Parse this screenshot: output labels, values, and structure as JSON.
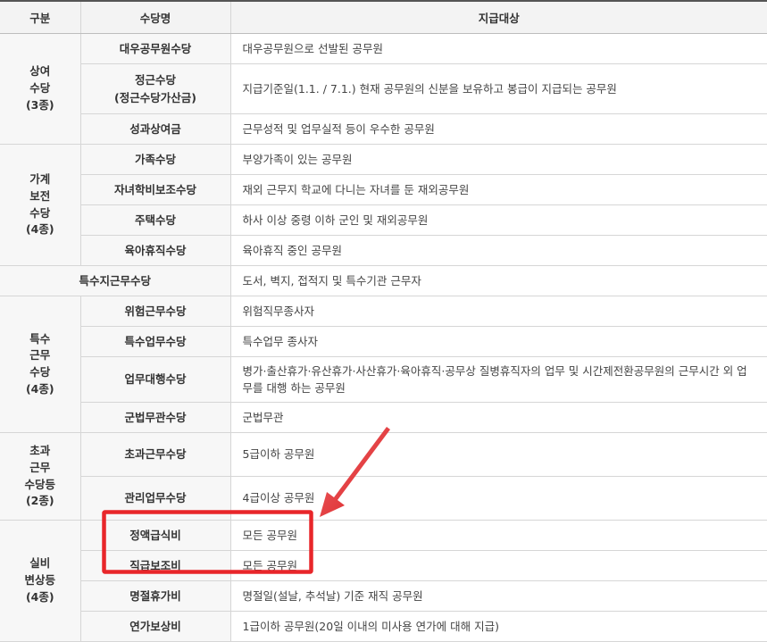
{
  "header": {
    "col1": "구분",
    "col2": "수당명",
    "col3": "지급대상"
  },
  "groups": {
    "g1": {
      "lines": [
        "상여",
        "수당",
        "(3종)"
      ]
    },
    "g2": {
      "lines": [
        "가계",
        "보전",
        "수당",
        "(4종)"
      ]
    },
    "g3": {
      "lines": [
        "특수",
        "근무",
        "수당",
        "(4종)"
      ]
    },
    "g4": {
      "lines": [
        "초과",
        "근무",
        "수당등",
        "(2종)"
      ]
    },
    "g5": {
      "lines": [
        "실비",
        "변상등",
        "(4종)"
      ]
    }
  },
  "rows": [
    {
      "name": "대우공무원수당",
      "target": "대우공무원으로 선발된 공무원"
    },
    {
      "name": "정근수당",
      "name_sub": "(정근수당가산금)",
      "target": "지급기준일(1.1. / 7.1.) 현재 공무원의 신분을 보유하고 봉급이 지급되는 공무원"
    },
    {
      "name": "성과상여금",
      "target": "근무성적 및 업무실적 등이 우수한 공무원"
    },
    {
      "name": "가족수당",
      "target": "부양가족이 있는 공무원"
    },
    {
      "name": "자녀학비보조수당",
      "target": "재외 근무지 학교에 다니는 자녀를 둔 재외공무원"
    },
    {
      "name": "주택수당",
      "target": "하사 이상 중령 이하 군인 및 재외공무원"
    },
    {
      "name": "육아휴직수당",
      "target": "육아휴직 중인 공무원"
    },
    {
      "name": "특수지근무수당",
      "target": "도서, 벽지, 접적지 및 특수기관 근무자"
    },
    {
      "name": "위험근무수당",
      "target": "위험직무종사자"
    },
    {
      "name": "특수업무수당",
      "target": "특수업무 종사자"
    },
    {
      "name": "업무대행수당",
      "target": "병가·출산휴가·유산휴가·사산휴가·육아휴직·공무상 질병휴직자의 업무 및 시간제전환공무원의 근무시간 외 업무를 대행 하는 공무원"
    },
    {
      "name": "군법무관수당",
      "target": "군법무관"
    },
    {
      "name": "초과근무수당",
      "target": "5급이하 공무원"
    },
    {
      "name": "관리업무수당",
      "target": "4급이상 공무원"
    },
    {
      "name": "정액급식비",
      "target": "모든 공무원"
    },
    {
      "name": "직급보조비",
      "target": "모든 공무원"
    },
    {
      "name": "명절휴가비",
      "target": "명절일(설날, 추석날) 기준 재직 공무원"
    },
    {
      "name": "연가보상비",
      "target": "1급이하 공무원(20일 이내의 미사용 연가에 대해 지급)"
    }
  ],
  "annotation": {
    "highlight_color": "#e8262a",
    "arrow_color": "#e8262a"
  }
}
